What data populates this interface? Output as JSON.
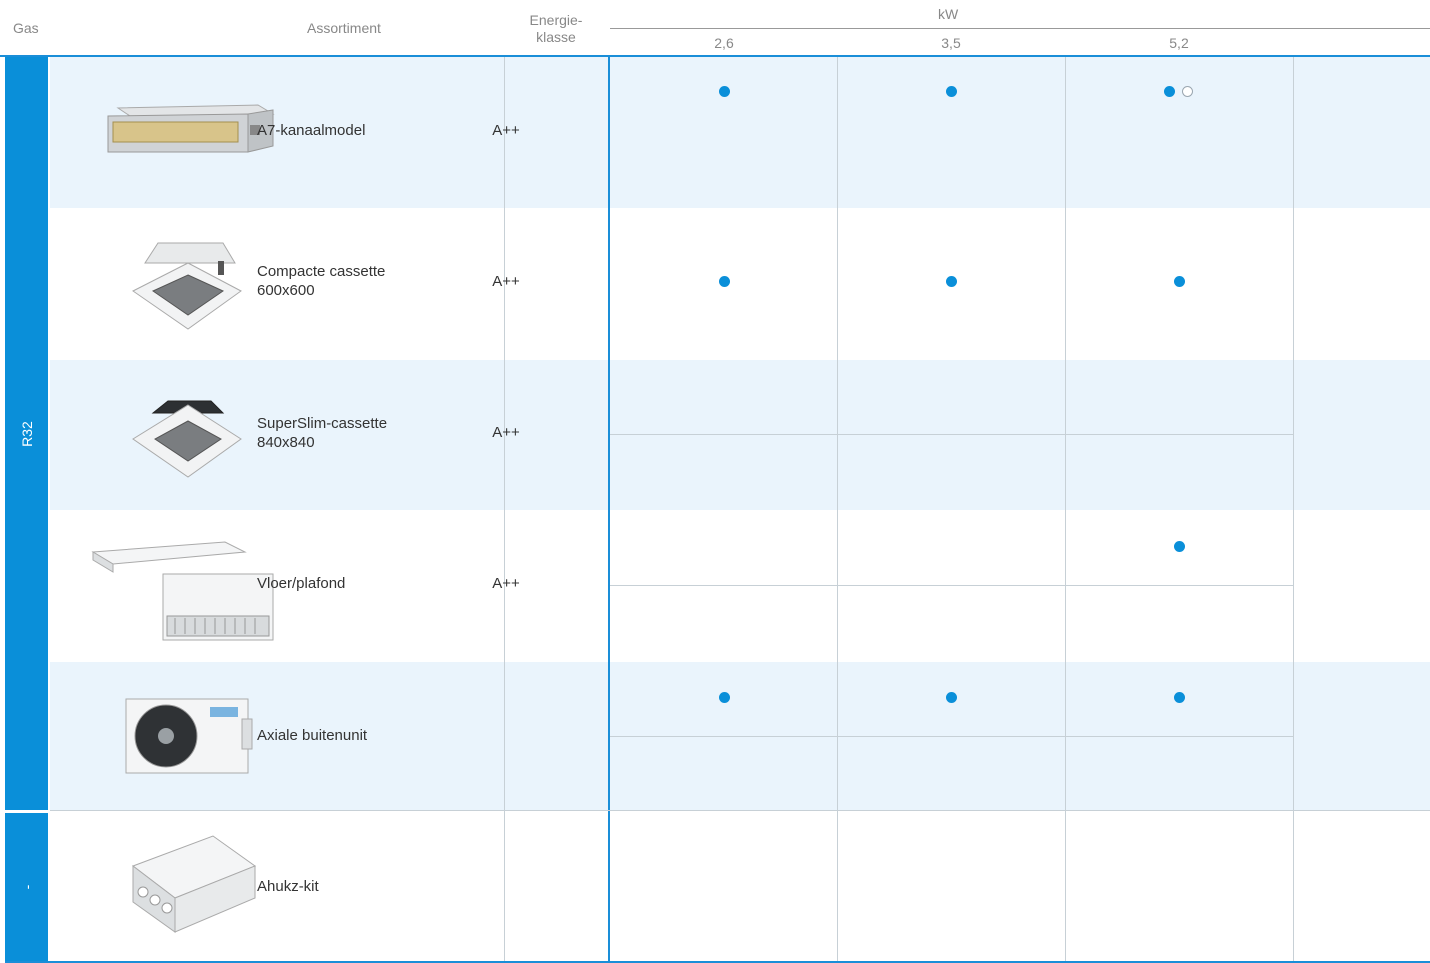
{
  "header": {
    "gas": "Gas",
    "assortment": "Assortiment",
    "energy_line1": "Energie-",
    "energy_line2": "klasse",
    "capacity_unit": "kW",
    "capacity_columns": [
      "2,6",
      "3,5",
      "5,2"
    ]
  },
  "gas_groups": [
    {
      "label": "R32",
      "rows": 5
    },
    {
      "label": "-",
      "rows": 1
    }
  ],
  "products": [
    {
      "name_line1": "A7-kanaalmodel",
      "name_line2": "",
      "energy": "A++",
      "image_icon": "ducted-unit-icon",
      "availability": [
        "filled",
        "filled",
        "filled+open"
      ]
    },
    {
      "name_line1": "Compacte cassette",
      "name_line2": "600x600",
      "energy": "A++",
      "image_icon": "cassette-600-icon",
      "availability": [
        "filled",
        "filled",
        "filled"
      ]
    },
    {
      "name_line1": "SuperSlim-cassette",
      "name_line2": "840x840",
      "energy": "A++",
      "image_icon": "cassette-840-icon",
      "availability": [
        "",
        "",
        ""
      ]
    },
    {
      "name_line1": "Vloer/plafond",
      "name_line2": "",
      "energy": "A++",
      "image_icon": "floor-ceiling-unit-icon",
      "availability": [
        "",
        "",
        "filled"
      ]
    },
    {
      "name_line1": "Axiale buitenunit",
      "name_line2": "",
      "energy": "",
      "image_icon": "outdoor-unit-icon",
      "availability": [
        "filled",
        "filled",
        "filled"
      ]
    },
    {
      "name_line1": "Ahukz-kit",
      "name_line2": "",
      "energy": "",
      "image_icon": "ahu-kit-box-icon",
      "availability": [
        "",
        "",
        ""
      ]
    }
  ],
  "colors": {
    "accent": "#0a8fd9",
    "row_shade": "#eaf4fc",
    "grid": "#c7d0d6"
  }
}
